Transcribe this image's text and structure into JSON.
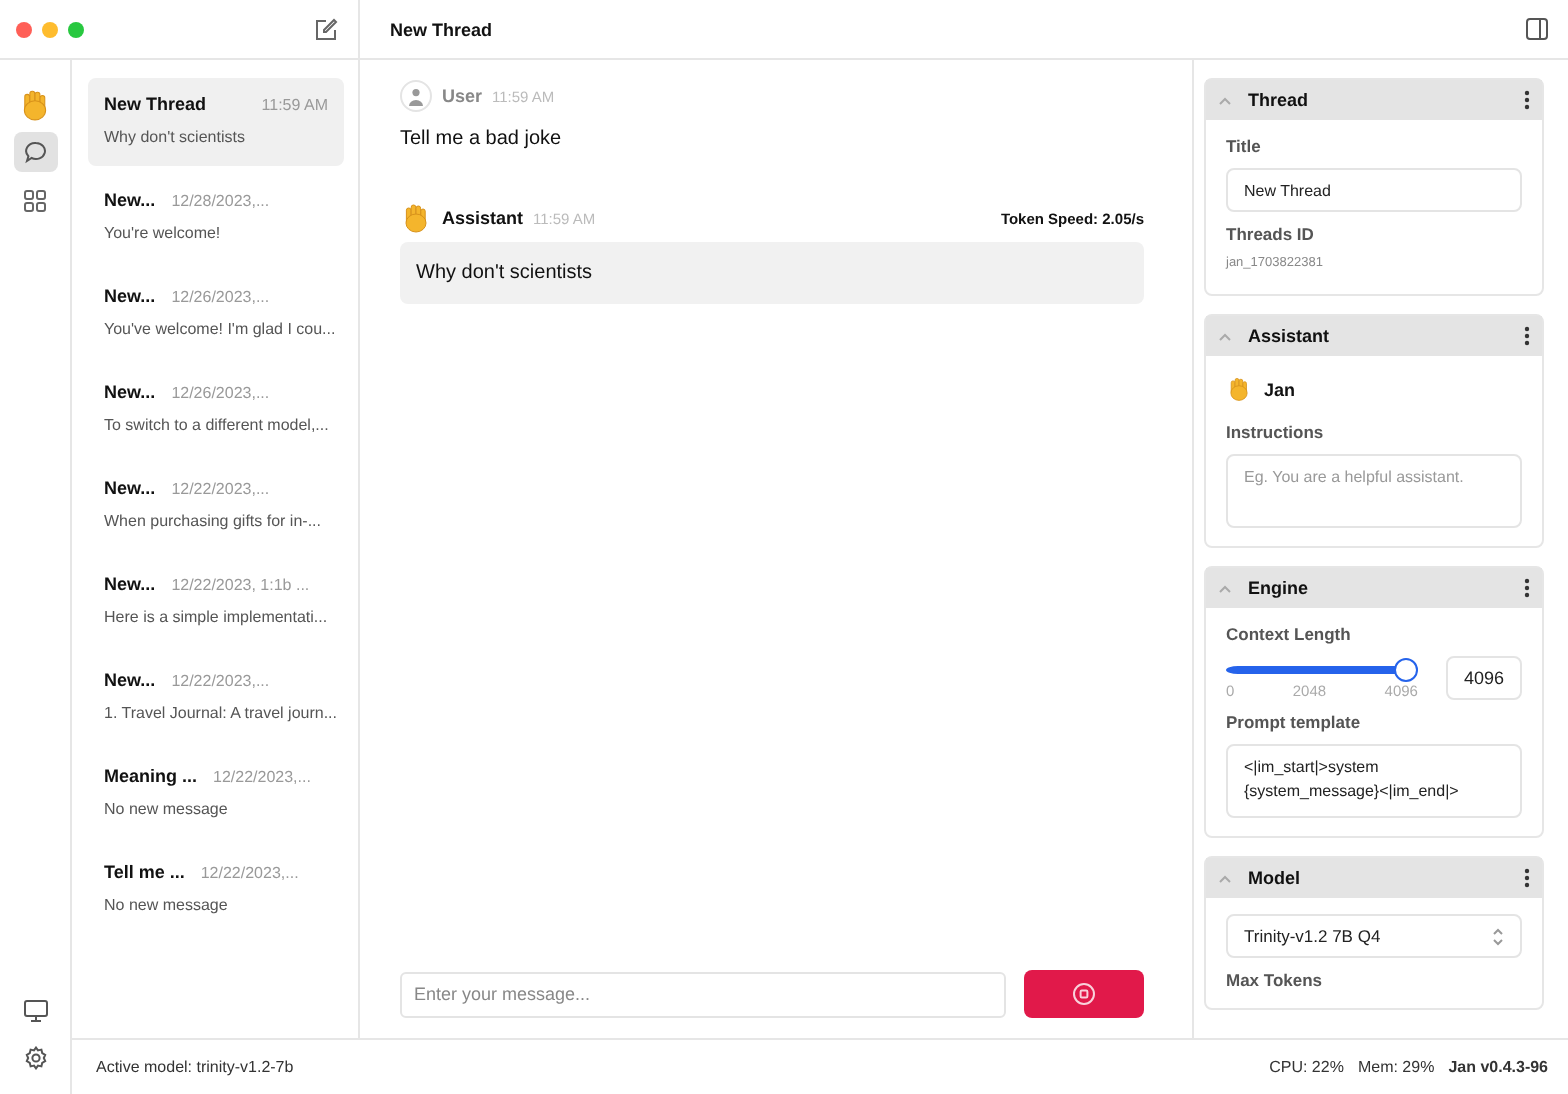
{
  "window": {
    "title": "New Thread"
  },
  "rail": {
    "top": [
      {
        "kind": "logo",
        "selected": false
      },
      {
        "kind": "chat",
        "selected": true
      },
      {
        "kind": "hub",
        "selected": false
      }
    ],
    "bottom": [
      {
        "kind": "monitor",
        "selected": false
      },
      {
        "kind": "settings",
        "selected": false
      }
    ]
  },
  "threads": [
    {
      "title": "New Thread",
      "time": "11:59 AM",
      "preview": "Why don't scientists",
      "selected": true
    },
    {
      "title": "New...",
      "time": "12/28/2023,...",
      "preview": "You're welcome!",
      "selected": false
    },
    {
      "title": "New...",
      "time": "12/26/2023,...",
      "preview": "You've welcome! I'm glad I cou...",
      "selected": false
    },
    {
      "title": "New...",
      "time": "12/26/2023,...",
      "preview": "To switch to a different model,...",
      "selected": false
    },
    {
      "title": "New...",
      "time": "12/22/2023,...",
      "preview": "When purchasing gifts for in-...",
      "selected": false
    },
    {
      "title": "New...",
      "time": "12/22/2023, 1:1b ...",
      "preview": "Here is a simple implementati...",
      "selected": false
    },
    {
      "title": "New...",
      "time": "12/22/2023,...",
      "preview": "1. Travel Journal: A travel journ...",
      "selected": false
    },
    {
      "title": "Meaning ...",
      "time": "12/22/2023,...",
      "preview": "No new message",
      "selected": false
    },
    {
      "title": "Tell me ...",
      "time": "12/22/2023,...",
      "preview": "No new message",
      "selected": false
    }
  ],
  "chat": {
    "messages": [
      {
        "kind": "user",
        "author": "User",
        "time": "11:59 AM",
        "text": "Tell me a bad joke"
      },
      {
        "kind": "assistant",
        "author": "Assistant",
        "time": "11:59 AM",
        "token_speed": "Token Speed: 2.05/s",
        "text": "Why don't scientists"
      }
    ],
    "composer": {
      "placeholder": "Enter your message...",
      "generating": true
    }
  },
  "panel": {
    "sections": [
      {
        "kind": "thread",
        "title": "Thread",
        "expanded": true,
        "title_label": "Title",
        "title_value": "New Thread",
        "id_label": "Threads ID",
        "id_value": "jan_1703822381"
      },
      {
        "kind": "assistant",
        "title": "Assistant",
        "expanded": true,
        "name": "Jan",
        "instructions_label": "Instructions",
        "instructions_placeholder": "Eg. You are a helpful assistant."
      },
      {
        "kind": "engine",
        "title": "Engine",
        "expanded": true,
        "context_label": "Context Length",
        "level": 1,
        "ticks": [
          "0",
          "2048",
          "4096"
        ],
        "context_value": "4096",
        "prompt_label": "Prompt template",
        "prompt_value": "<|im_start|>system\n{system_message}<|im_end|>"
      },
      {
        "kind": "model",
        "title": "Model",
        "expanded": true,
        "model_value": "Trinity-v1.2 7B Q4",
        "max_tokens_label": "Max Tokens"
      }
    ]
  },
  "status_bar": {
    "active_model": "Active model: trinity-v1.2-7b",
    "cpu": "CPU: 22%",
    "mem": "Mem: 29%",
    "version": "Jan v0.4.3-96"
  }
}
